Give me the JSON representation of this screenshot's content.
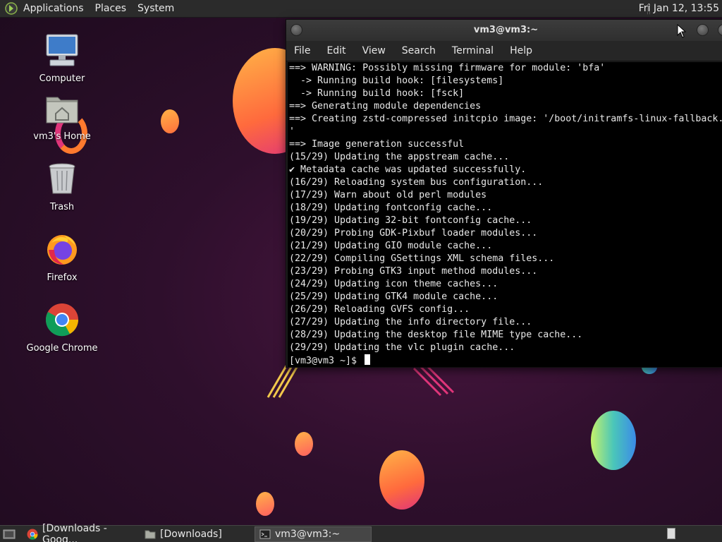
{
  "top_panel": {
    "menus": [
      "Applications",
      "Places",
      "System"
    ],
    "clock": "Fri Jan 12, 13:55"
  },
  "desktop_icons": [
    {
      "label": "Computer",
      "icon": "computer-icon"
    },
    {
      "label": "vm3's Home",
      "icon": "home-folder-icon"
    },
    {
      "label": "Trash",
      "icon": "trash-icon"
    },
    {
      "label": "Firefox",
      "icon": "firefox-icon"
    },
    {
      "label": "Google Chrome",
      "icon": "chrome-icon"
    }
  ],
  "terminal": {
    "title": "vm3@vm3:~",
    "menu": [
      "File",
      "Edit",
      "View",
      "Search",
      "Terminal",
      "Help"
    ],
    "lines": [
      "==> WARNING: Possibly missing firmware for module: 'bfa'",
      "  -> Running build hook: [filesystems]",
      "  -> Running build hook: [fsck]",
      "==> Generating module dependencies",
      "==> Creating zstd-compressed initcpio image: '/boot/initramfs-linux-fallback.img",
      "'",
      "==> Image generation successful",
      "(15/29) Updating the appstream cache...",
      "✔ Metadata cache was updated successfully.",
      "(16/29) Reloading system bus configuration...",
      "(17/29) Warn about old perl modules",
      "(18/29) Updating fontconfig cache...",
      "(19/29) Updating 32-bit fontconfig cache...",
      "(20/29) Probing GDK-Pixbuf loader modules...",
      "(21/29) Updating GIO module cache...",
      "(22/29) Compiling GSettings XML schema files...",
      "(23/29) Probing GTK3 input method modules...",
      "(24/29) Updating icon theme caches...",
      "(25/29) Updating GTK4 module cache...",
      "(26/29) Reloading GVFS config...",
      "(27/29) Updating the info directory file...",
      "(28/29) Updating the desktop file MIME type cache...",
      "(29/29) Updating the vlc plugin cache..."
    ],
    "prompt": "[vm3@vm3 ~]$ "
  },
  "taskbar": {
    "tasks": [
      {
        "label": "[Downloads - Goog...",
        "icon": "chrome-icon",
        "active": false
      },
      {
        "label": "[Downloads]",
        "icon": "folder-icon",
        "active": false
      },
      {
        "label": "vm3@vm3:~",
        "icon": "terminal-icon",
        "active": true
      }
    ]
  },
  "colors": {
    "desktop_bg": "#2e0f2c",
    "panel_bg": "#2b2b2b",
    "terminal_bg": "#000000",
    "terminal_fg": "#e8e8e8"
  }
}
